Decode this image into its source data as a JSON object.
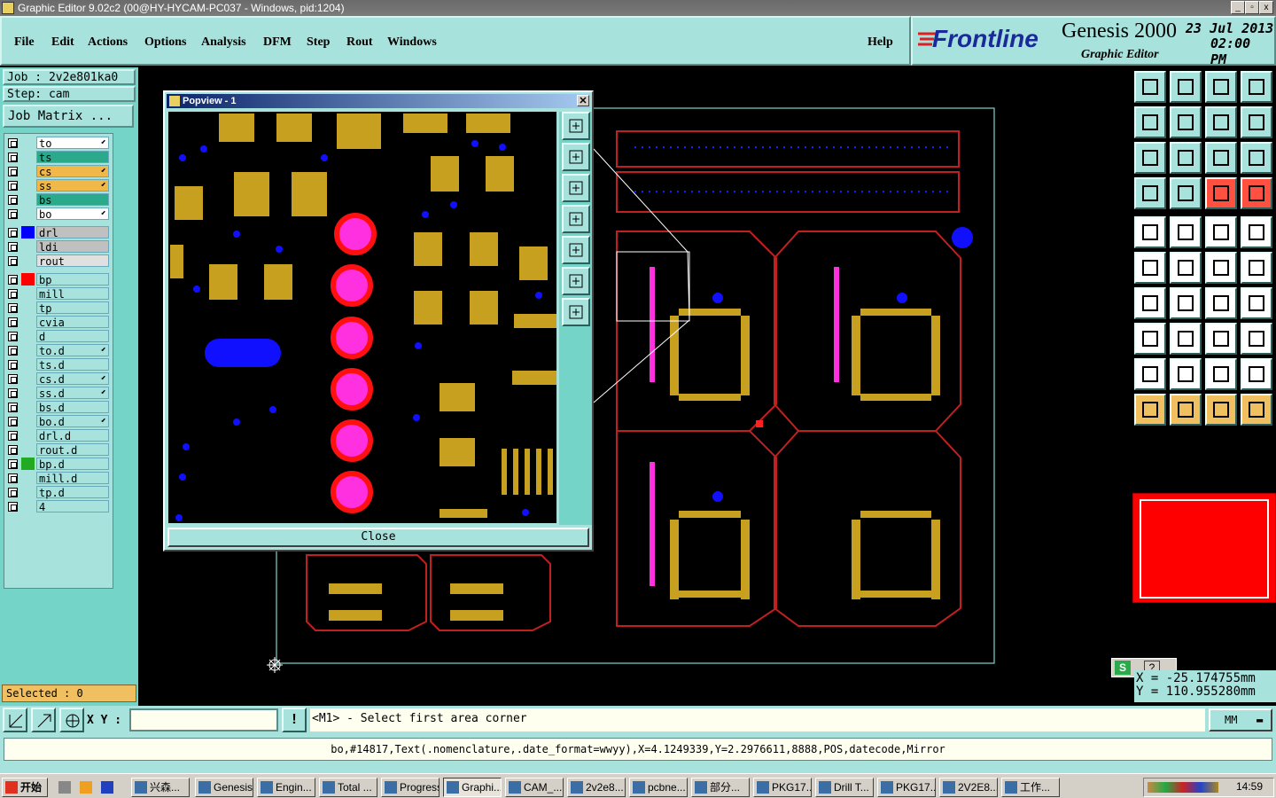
{
  "window": {
    "title": "Graphic Editor 9.02c2 (00@HY-HYCAM-PC037 - Windows, pid:1204)"
  },
  "menu": [
    "File",
    "Edit",
    "Actions",
    "Options",
    "Analysis",
    "DFM",
    "Step",
    "Rout",
    "Windows"
  ],
  "help_label": "Help",
  "brand": {
    "logo": "Frontline",
    "product": "Genesis 2000",
    "subtitle": "Graphic Editor",
    "date": "23 Jul 2013",
    "time": "02:00 PM"
  },
  "job": {
    "job_label": "Job : 2v2e801ka0",
    "step_label": "Step: cam",
    "matrix_button": "Job Matrix ..."
  },
  "layers_group1": [
    {
      "name": "to",
      "color": "#ffffff",
      "mark": true
    },
    {
      "name": "ts",
      "color": "#2aaa8a",
      "mark": false
    },
    {
      "name": "cs",
      "color": "#f0b848",
      "mark": true
    },
    {
      "name": "ss",
      "color": "#f0b848",
      "mark": true
    },
    {
      "name": "bs",
      "color": "#2aaa8a",
      "mark": false
    },
    {
      "name": "bo",
      "color": "#ffffff",
      "mark": true
    }
  ],
  "layers_group2": [
    {
      "name": "drl",
      "swatch": "#0000ff",
      "color": "#c0c0c0"
    },
    {
      "name": "ldi",
      "swatch": "",
      "color": "#c0c0c0"
    },
    {
      "name": "rout",
      "swatch": "",
      "color": "#e0e0e0"
    }
  ],
  "layers_group3": [
    {
      "name": "bp",
      "swatch": "#ff0000",
      "mark": false
    },
    {
      "name": "mill",
      "swatch": "",
      "mark": false
    },
    {
      "name": "tp",
      "swatch": "",
      "mark": false
    },
    {
      "name": "cvia",
      "swatch": "",
      "mark": false
    },
    {
      "name": "d",
      "swatch": "",
      "mark": false
    },
    {
      "name": "to.d",
      "swatch": "",
      "mark": true
    },
    {
      "name": "ts.d",
      "swatch": "",
      "mark": false
    },
    {
      "name": "cs.d",
      "swatch": "",
      "mark": true
    },
    {
      "name": "ss.d",
      "swatch": "",
      "mark": true
    },
    {
      "name": "bs.d",
      "swatch": "",
      "mark": false
    },
    {
      "name": "bo.d",
      "swatch": "",
      "mark": true
    },
    {
      "name": "drl.d",
      "swatch": "",
      "mark": false
    },
    {
      "name": "rout.d",
      "swatch": "",
      "mark": false
    },
    {
      "name": "bp.d",
      "swatch": "#22aa22",
      "mark": false
    },
    {
      "name": "mill.d",
      "swatch": "",
      "mark": false
    },
    {
      "name": "tp.d",
      "swatch": "",
      "mark": false
    },
    {
      "name": "4",
      "swatch": "",
      "mark": false
    }
  ],
  "selected": "Selected : 0",
  "popview": {
    "title": "Popview - 1",
    "close_label": "Close"
  },
  "coords": {
    "x": "X = -25.174755mm",
    "y": "Y = 110.955280mm"
  },
  "bottom": {
    "xy_label": "X Y :",
    "xy_value": "",
    "prompt": "<M1> - Select first area corner",
    "units": "MM"
  },
  "status": "bo,#14817,Text(.nomenclature,.date_format=wwyy),X=4.1249339,Y=2.2976611,8888,POS,datecode,Mirror",
  "taskbar": {
    "start": "开始",
    "tasks": [
      "兴森...",
      "Genesis",
      "Engin...",
      "Total ...",
      "Progress",
      "Graphi...",
      "CAM_...",
      "2v2e8...",
      "pcbne...",
      "部分...",
      "PKG17...",
      "Drill T...",
      "PKG17...",
      "2V2E8...",
      "工作..."
    ],
    "clock": "14:59"
  },
  "colors": {
    "menu_bg": "#a7e2dc",
    "sidebar_bg": "#74d4c8",
    "copper": "#c8a020",
    "outline": "#c02020",
    "drill": "#1010ff",
    "pad": "#ff30e0"
  }
}
